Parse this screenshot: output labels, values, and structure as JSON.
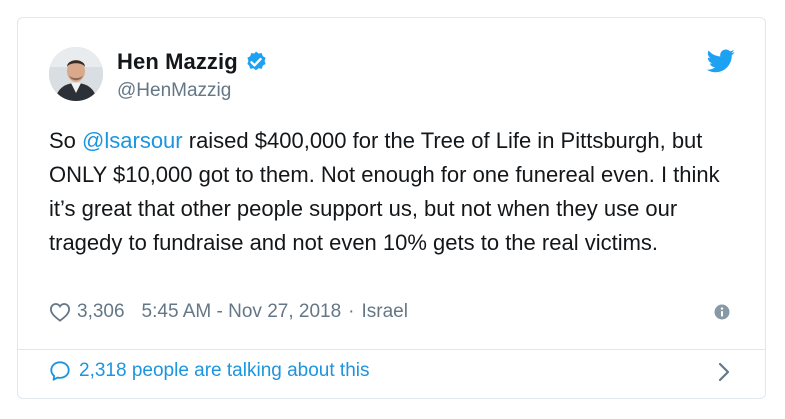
{
  "user": {
    "display_name": "Hen Mazzig",
    "handle": "@HenMazzig"
  },
  "tweet": {
    "text_before_mention": "So ",
    "mention": "@lsarsour",
    "text_after_mention": " raised $400,000 for the Tree of Life in Pittsburgh, but ONLY $10,000 got to them. Not enough for one funereal even. I think it’s great that other people support us, but not when they use our tragedy to fundraise and not even 10% gets to the real victims."
  },
  "meta": {
    "likes": "3,306",
    "timestamp": "5:45 AM - Nov 27, 2018",
    "separator": "·",
    "location": "Israel"
  },
  "footer": {
    "talking_text": "2,318 people are talking about this"
  },
  "colors": {
    "accent": "#1b95e0",
    "muted": "#657786",
    "border": "#e1e8ed",
    "bird": "#1da1f2"
  },
  "icons": {
    "avatar": "profile-photo",
    "verified": "verified-badge-icon",
    "brand": "twitter-bird-icon",
    "like": "heart-icon",
    "info": "info-icon",
    "reply": "speech-bubble-icon",
    "next": "chevron-right-icon"
  }
}
